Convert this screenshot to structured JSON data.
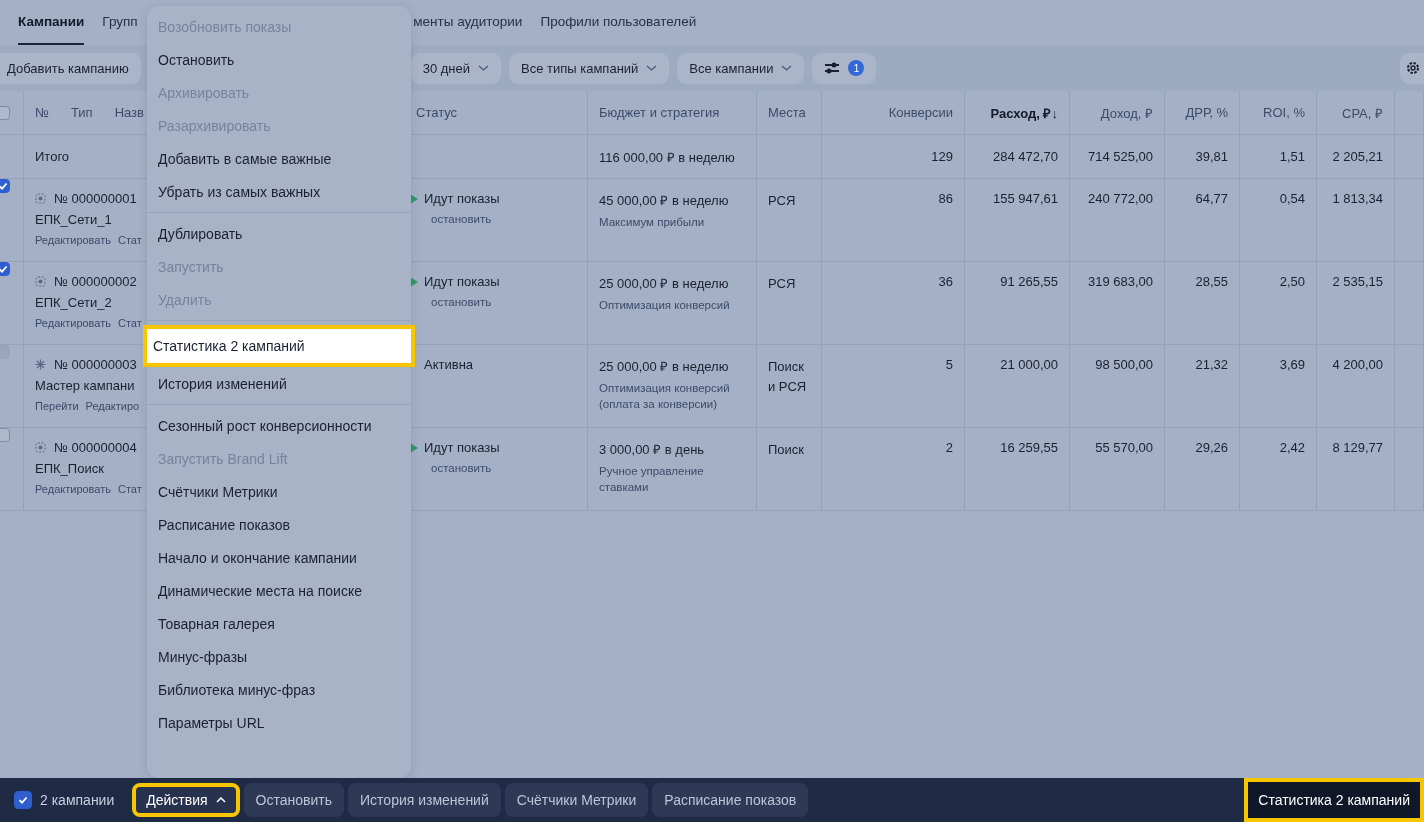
{
  "tabs": [
    {
      "label": "Кампании",
      "selected": true
    },
    {
      "label": "Групп",
      "selected": false
    },
    {
      "label": "менты аудитории",
      "selected": false
    },
    {
      "label": "Профили пользователей",
      "selected": false
    }
  ],
  "toolbar": {
    "add_button": "Добавить кампанию",
    "period": "30 дней",
    "types": "Все типы кампаний",
    "campaigns": "Все кампании",
    "filter_count": "1"
  },
  "table": {
    "select_all": {
      "checked": false
    },
    "campaign_labels": [
      "№",
      "Тип",
      "Назв"
    ],
    "columns": [
      {
        "label": "Статус",
        "kind": "text",
        "sorted": false
      },
      {
        "label": "Бюджет и стратегия",
        "kind": "text",
        "sorted": false
      },
      {
        "label": "Места",
        "kind": "text",
        "sorted": false
      },
      {
        "label": "Конверсии",
        "kind": "numeric",
        "sorted": false
      },
      {
        "label": "Расход, ₽↓",
        "kind": "numeric",
        "sorted": true
      },
      {
        "label": "Доход, ₽",
        "kind": "numeric",
        "sorted": false
      },
      {
        "label": "ДРР, %",
        "kind": "numeric",
        "sorted": false
      },
      {
        "label": "ROI, %",
        "kind": "numeric",
        "sorted": false
      },
      {
        "label": "CPA, ₽",
        "kind": "numeric",
        "sorted": false
      }
    ],
    "total": {
      "label": "Итого",
      "budget": "116 000,00 ₽ в неделю",
      "values": [
        "129",
        "284 472,70",
        "714 525,00",
        "39,81",
        "1,51",
        "2 205,21"
      ]
    },
    "rows": [
      {
        "checked": true,
        "disabled": false,
        "kind": "target",
        "number": "№ 000000001",
        "name": "ЕПК_Сети_1",
        "links": [
          "Редактировать",
          "Стат"
        ],
        "status": {
          "kind": "running",
          "label": "Идут показы",
          "action": "остановить"
        },
        "budget": "45 000,00 ₽ в неделю",
        "strategy": "Максимум прибыли",
        "places": "РСЯ",
        "values": [
          "86",
          "155 947,61",
          "240 772,00",
          "64,77",
          "0,54",
          "1 813,34"
        ]
      },
      {
        "checked": true,
        "disabled": false,
        "kind": "target",
        "number": "№ 000000002",
        "name": "ЕПК_Сети_2",
        "links": [
          "Редактировать",
          "Стат"
        ],
        "status": {
          "kind": "running",
          "label": "Идут показы",
          "action": "остановить"
        },
        "budget": "25 000,00 ₽ в неделю",
        "strategy": "Оптимизация конверсий",
        "places": "РСЯ",
        "values": [
          "36",
          "91 265,55",
          "319 683,00",
          "28,55",
          "2,50",
          "2 535,15"
        ]
      },
      {
        "checked": false,
        "disabled": true,
        "kind": "spark",
        "number": "№ 000000003",
        "name": "Мастер кампани",
        "links": [
          "Перейти",
          "Редактиро"
        ],
        "status": {
          "kind": "active",
          "label": "Активна"
        },
        "budget": "25 000,00 ₽ в неделю",
        "strategy": "Оптимизация конверсий (оплата за конверсии)",
        "places": "Поиск и РСЯ",
        "values": [
          "5",
          "21 000,00",
          "98 500,00",
          "21,32",
          "3,69",
          "4 200,00"
        ]
      },
      {
        "checked": false,
        "disabled": false,
        "kind": "target",
        "number": "№ 000000004",
        "name": "ЕПК_Поиск",
        "links": [
          "Редактировать",
          "Стат"
        ],
        "status": {
          "kind": "running",
          "label": "Идут показы",
          "action": "остановить"
        },
        "budget": "3 000,00 ₽ в день",
        "strategy": "Ручное управление ставками",
        "places": "Поиск",
        "values": [
          "2",
          "16 259,55",
          "55 570,00",
          "29,26",
          "2,42",
          "8 129,77"
        ]
      }
    ]
  },
  "menu": {
    "groups": [
      [
        {
          "label": "Возобновить показы",
          "disabled": true,
          "highlighted": false
        },
        {
          "label": "Остановить",
          "disabled": false,
          "highlighted": false
        },
        {
          "label": "Архивировать",
          "disabled": true,
          "highlighted": false
        },
        {
          "label": "Разархивировать",
          "disabled": true,
          "highlighted": false
        },
        {
          "label": "Добавить в самые важные",
          "disabled": false,
          "highlighted": false
        },
        {
          "label": "Убрать из самых важных",
          "disabled": false,
          "highlighted": false
        }
      ],
      [
        {
          "label": "Дублировать",
          "disabled": false,
          "highlighted": false
        },
        {
          "label": "Запустить",
          "disabled": true,
          "highlighted": false
        },
        {
          "label": "Удалить",
          "disabled": true,
          "highlighted": false
        }
      ],
      [
        {
          "label": "Статистика 2 кампаний",
          "disabled": false,
          "highlighted": true
        },
        {
          "label": "История изменений",
          "disabled": false,
          "highlighted": false
        }
      ],
      [
        {
          "label": "Сезонный рост конверсионности",
          "disabled": false,
          "highlighted": false
        },
        {
          "label": "Запустить Brand Lift",
          "disabled": true,
          "highlighted": false
        },
        {
          "label": "Счётчики Метрики",
          "disabled": false,
          "highlighted": false
        },
        {
          "label": "Расписание показов",
          "disabled": false,
          "highlighted": false
        },
        {
          "label": "Начало и окончание кампании",
          "disabled": false,
          "highlighted": false
        },
        {
          "label": "Динамические места на поиске",
          "disabled": false,
          "highlighted": false
        },
        {
          "label": "Товарная галерея",
          "disabled": false,
          "highlighted": false
        },
        {
          "label": "Минус-фразы",
          "disabled": false,
          "highlighted": false
        },
        {
          "label": "Библиотека минус-фраз",
          "disabled": false,
          "highlighted": false
        },
        {
          "label": "Параметры URL",
          "disabled": false,
          "highlighted": false
        }
      ]
    ]
  },
  "action_bar": {
    "selection": {
      "checked": true,
      "label": "2 кампании"
    },
    "buttons": [
      {
        "label": "Действия",
        "highlighted": true,
        "kind": "dropdown"
      },
      {
        "label": "Остановить",
        "highlighted": false,
        "kind": "plain"
      },
      {
        "label": "История изменений",
        "highlighted": false,
        "kind": "plain"
      },
      {
        "label": "Счётчики Метрики",
        "highlighted": false,
        "kind": "plain"
      },
      {
        "label": "Расписание показов",
        "highlighted": false,
        "kind": "plain"
      }
    ],
    "right_button": {
      "label": "Статистика 2 кампаний",
      "highlighted": true
    }
  }
}
